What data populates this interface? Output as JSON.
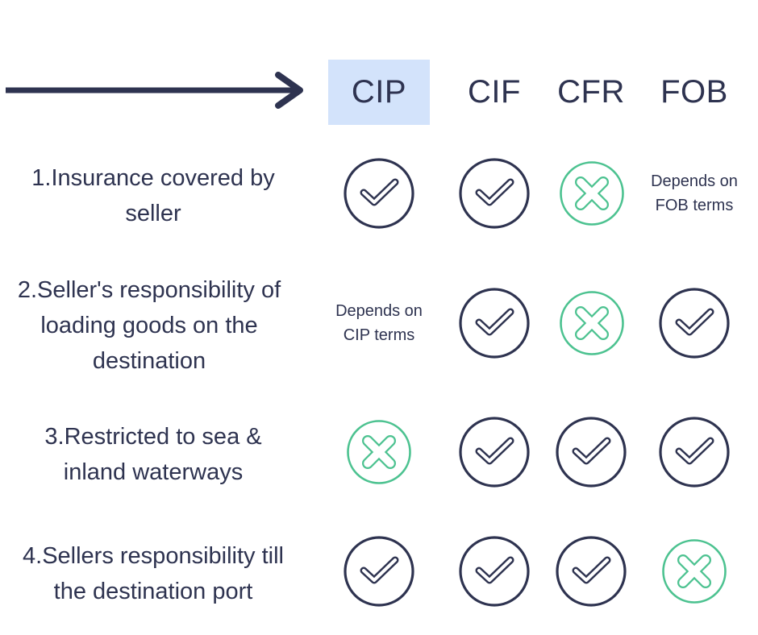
{
  "colors": {
    "ink": "#2e3350",
    "highlight": "#d3e3fb",
    "yes": "#2e3350",
    "no": "#4cc290"
  },
  "header": {
    "arrow_icon": "right-arrow-icon",
    "columns": [
      {
        "label": "CIP",
        "highlighted": true
      },
      {
        "label": "CIF",
        "highlighted": false
      },
      {
        "label": "CFR",
        "highlighted": false
      },
      {
        "label": "FOB",
        "highlighted": false
      }
    ]
  },
  "rows": [
    {
      "label": "1.Insurance covered by seller",
      "label_lines": [
        "1.Insurance covered by",
        "seller"
      ],
      "cells": [
        {
          "type": "check",
          "icon": "check-circle-icon"
        },
        {
          "type": "check",
          "icon": "check-circle-icon"
        },
        {
          "type": "cross",
          "icon": "cross-circle-icon"
        },
        {
          "type": "text",
          "lines": [
            "Depends on",
            "FOB terms"
          ]
        }
      ]
    },
    {
      "label": "2.Seller's responsibility of loading goods on the destination",
      "label_lines": [
        "2.Seller's responsibility of",
        "loading goods on the",
        "destination"
      ],
      "cells": [
        {
          "type": "text",
          "lines": [
            "Depends on",
            "CIP terms"
          ]
        },
        {
          "type": "check",
          "icon": "check-circle-icon"
        },
        {
          "type": "cross",
          "icon": "cross-circle-icon"
        },
        {
          "type": "check",
          "icon": "check-circle-icon"
        }
      ]
    },
    {
      "label": "3.Restricted to sea & inland waterways",
      "label_lines": [
        "3.Restricted to sea &",
        "inland waterways"
      ],
      "cells": [
        {
          "type": "cross",
          "icon": "cross-circle-icon"
        },
        {
          "type": "check",
          "icon": "check-circle-icon"
        },
        {
          "type": "check",
          "icon": "check-circle-icon"
        },
        {
          "type": "check",
          "icon": "check-circle-icon"
        }
      ]
    },
    {
      "label": "4.Sellers responsibility till the destination port",
      "label_lines": [
        "4.Sellers responsibility till",
        "the destination port"
      ],
      "cells": [
        {
          "type": "check",
          "icon": "check-circle-icon"
        },
        {
          "type": "check",
          "icon": "check-circle-icon"
        },
        {
          "type": "check",
          "icon": "check-circle-icon"
        },
        {
          "type": "cross",
          "icon": "cross-circle-icon"
        }
      ]
    }
  ]
}
